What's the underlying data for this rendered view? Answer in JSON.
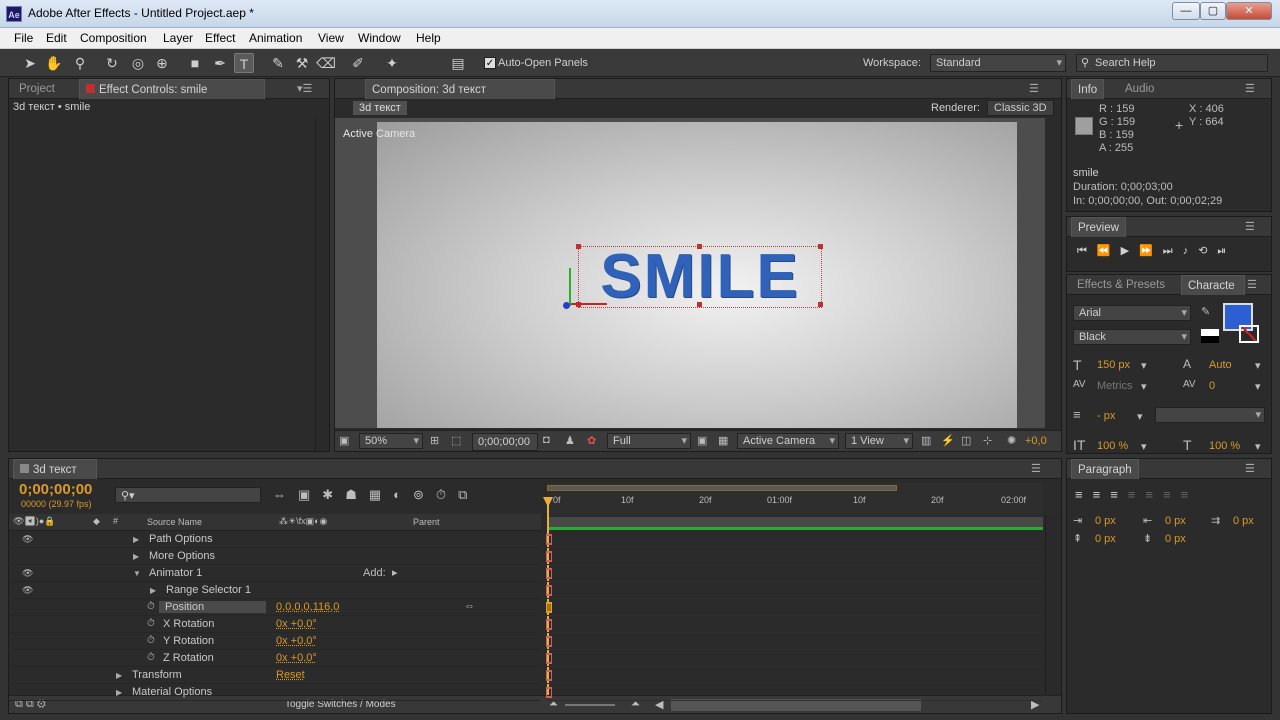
{
  "window": {
    "title": "Adobe After Effects - Untitled Project.aep *",
    "app_badge": "Ae",
    "minimize": "—",
    "maximize": "▢",
    "close": "✕"
  },
  "menu": [
    "File",
    "Edit",
    "Composition",
    "Layer",
    "Effect",
    "Animation",
    "View",
    "Window",
    "Help"
  ],
  "toolbar": {
    "auto_open": "Auto-Open Panels",
    "workspace_label": "Workspace:",
    "workspace_value": "Standard",
    "search_placeholder": "Search Help"
  },
  "project_panel": {
    "tab_project": "Project",
    "tab_effects": "Effect Controls: smile",
    "subtitle": "3d текст • smile"
  },
  "comp_panel": {
    "tab": "Composition: 3d текст",
    "comp_chip": "3d текст",
    "renderer_label": "Renderer:",
    "renderer_value": "Classic 3D",
    "active_camera": "Active Camera",
    "text": "SMILE"
  },
  "viewer_bar": {
    "zoom": "50%",
    "timecode": "0;00;00;00",
    "resolution": "Full",
    "camera": "Active Camera",
    "views": "1 View",
    "exposure": "+0,0"
  },
  "info_panel": {
    "tab_info": "Info",
    "tab_audio": "Audio",
    "r": "R : 159",
    "g": "G : 159",
    "b": "B : 159",
    "a": "A : 255",
    "x": "X : 406",
    "y": "Y : 664",
    "layer": "smile",
    "duration": "Duration: 0;00;03;00",
    "inout": "In: 0;00;00;00, Out: 0;00;02;29",
    "swatch": "#9f9f9f"
  },
  "preview_panel": {
    "tab": "Preview"
  },
  "character_panel": {
    "tab_effects": "Effects & Presets",
    "tab_char": "Characte",
    "font": "Arial",
    "style": "Black",
    "size": "150 px",
    "leading": "Auto",
    "kerning": "Metrics",
    "tracking": "0",
    "stroke": "- px",
    "vscale": "100 %",
    "hscale": "100 %",
    "fill": "#2c5fd3"
  },
  "paragraph_panel": {
    "tab": "Paragraph",
    "indent1": "0 px",
    "indent2": "0 px",
    "indent3": "0 px",
    "space1": "0 px",
    "space2": "0 px"
  },
  "timeline": {
    "tab": "3d текст",
    "timecode": "0;00;00;00",
    "fps": "00000 (29.97 fps)",
    "col_source": "Source Name",
    "col_parent": "Parent",
    "ruler": [
      "0f",
      "10f",
      "20f",
      "01:00f",
      "10f",
      "20f",
      "02:00f"
    ],
    "toggle": "Toggle Switches / Modes",
    "rows": [
      {
        "label": "Path Options",
        "indent": 1,
        "tri": "▶",
        "eye": true
      },
      {
        "label": "More Options",
        "indent": 1,
        "tri": "▶",
        "eye": false
      },
      {
        "label": "Animator 1",
        "indent": 1,
        "tri": "▼",
        "eye": true,
        "extra": "Add:"
      },
      {
        "label": "Range Selector 1",
        "indent": 2,
        "tri": "▶",
        "eye": true
      },
      {
        "label": "Position",
        "indent": 3,
        "stopwatch": true,
        "value": "0,0,0,0,116,0",
        "selected": true
      },
      {
        "label": "X Rotation",
        "indent": 3,
        "stopwatch": true,
        "value": "0x +0,0°"
      },
      {
        "label": "Y Rotation",
        "indent": 3,
        "stopwatch": true,
        "value": "0x +0,0°"
      },
      {
        "label": "Z Rotation",
        "indent": 3,
        "stopwatch": true,
        "value": "0x +0,0°"
      },
      {
        "label": "Transform",
        "indent": 0,
        "tri": "▶",
        "value": "Reset"
      },
      {
        "label": "Material Options",
        "indent": 0,
        "tri": "▶"
      }
    ]
  },
  "accent": "#d89a28"
}
